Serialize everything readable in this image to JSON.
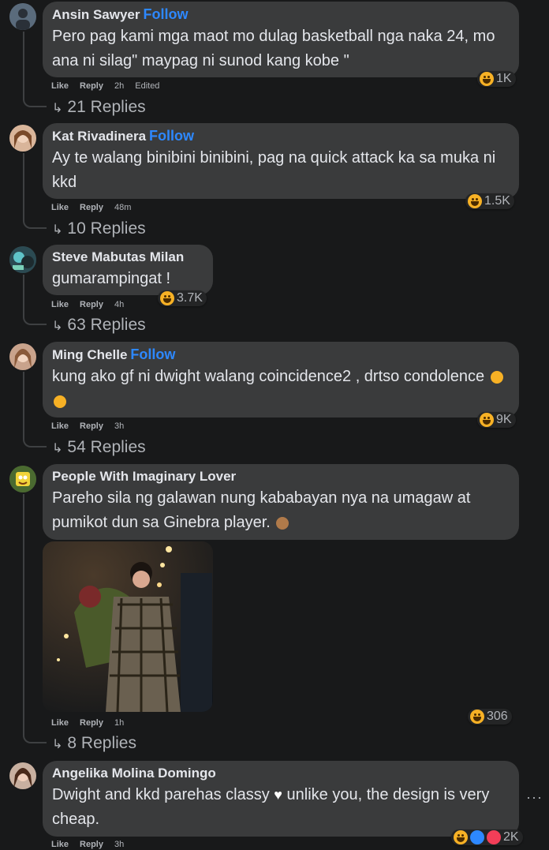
{
  "comments": [
    {
      "author": "Ansin Sawyer",
      "follow": "Follow",
      "text": "Pero pag kami mga maot mo dulag basketball nga naka 24, mo ana ni silag\" maypag ni sunod kang kobe \"",
      "like": "Like",
      "reply": "Reply",
      "time": "2h",
      "edited": "Edited",
      "reactions": "1K",
      "replies": "21 Replies"
    },
    {
      "author": "Kat Rivadinera",
      "follow": "Follow",
      "text": "Ay te walang binibini binibini, pag na quick attack ka sa muka ni kkd",
      "like": "Like",
      "reply": "Reply",
      "time": "48m",
      "reactions": "1.5K",
      "replies": "10 Replies"
    },
    {
      "author": "Steve Mabutas Milan",
      "text": "gumarampingat !",
      "like": "Like",
      "reply": "Reply",
      "time": "4h",
      "reactions": "3.7K",
      "replies": "63 Replies"
    },
    {
      "author": "Ming Chelle",
      "follow": "Follow",
      "text": "kung ako gf ni dwight walang coincidence2 , drtso condolence",
      "like": "Like",
      "reply": "Reply",
      "time": "3h",
      "reactions": "9K",
      "replies": "54 Replies"
    },
    {
      "author": "People With Imaginary Lover",
      "text": "Pareho sila ng galawan nung kababayan nya na umagaw at pumikot dun sa Ginebra player.",
      "like": "Like",
      "reply": "Reply",
      "time": "1h",
      "reactions": "306",
      "replies": "8 Replies"
    },
    {
      "author": "Angelika Molina Domingo",
      "text_a": "Dwight and kkd parehas classy",
      "text_b": "unlike you, the design is very cheap.",
      "like": "Like",
      "reply": "Reply",
      "time": "3h",
      "reactions": "2K"
    }
  ],
  "colors": {
    "background": "#18191a",
    "bubble": "#3a3b3c",
    "link": "#2d88ff",
    "muted": "#b0b3b8"
  },
  "icons": [
    "reply-arrow-icon",
    "haha-emoji-icon",
    "like-reaction-icon",
    "heart-reaction-icon",
    "more-dots-icon"
  ]
}
